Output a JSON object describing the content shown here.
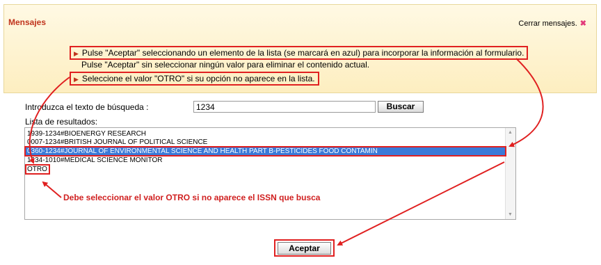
{
  "messages": {
    "title": "Mensajes",
    "close_label": "Cerrar mensajes.",
    "close_icon": "✖",
    "lines": [
      "Pulse \"Aceptar\" seleccionando un elemento de la lista (se marcará en azul) para incorporar la información al formulario.",
      "Pulse \"Aceptar\" sin seleccionar ningún valor para eliminar el contenido actual.",
      "Seleccione el valor \"OTRO\" si su opción no aparece en la lista."
    ]
  },
  "search": {
    "label": "Introduzca el texto de búsqueda :",
    "value": "1234",
    "button": "Buscar"
  },
  "results": {
    "label": "Lista de resultados:",
    "items": [
      "1939-1234#BIOENERGY RESEARCH",
      "0007-1234#BRITISH JOURNAL OF POLITICAL SCIENCE",
      "0360-1234#JOURNAL OF ENVIRONMENTAL SCIENCE AND HEALTH PART B-PESTICIDES FOOD CONTAMIN",
      "1234-1010#MEDICAL SCIENCE MONITOR",
      "OTRO"
    ],
    "selected_index": 2
  },
  "annotation": "Debe seleccionar el valor OTRO si no aparece el ISSN que busca",
  "accept_button": "Aceptar",
  "colors": {
    "highlight": "#e02020",
    "selection": "#3a7ad8",
    "title": "#c0341d"
  }
}
